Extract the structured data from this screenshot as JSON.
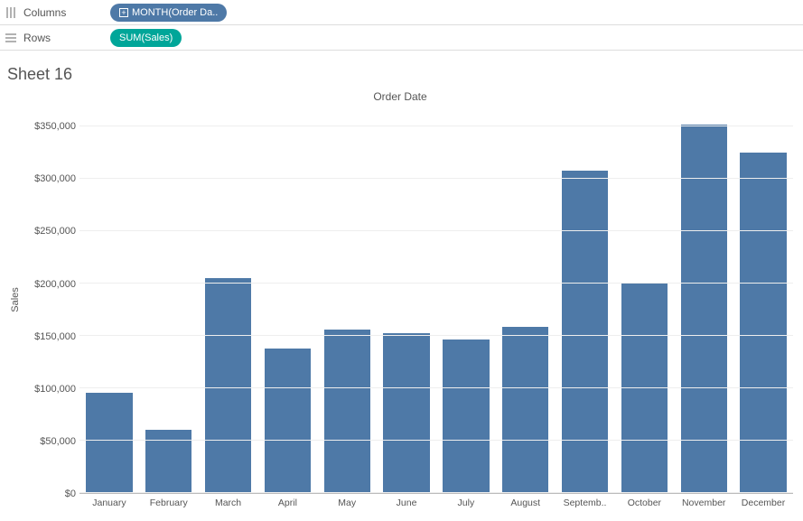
{
  "shelves": {
    "columns_label": "Columns",
    "rows_label": "Rows",
    "columns_pill": "MONTH(Order Da..",
    "rows_pill": "SUM(Sales)"
  },
  "sheet": {
    "title": "Sheet 16"
  },
  "chart_data": {
    "type": "bar",
    "title": "Order Date",
    "xlabel": "",
    "ylabel": "Sales",
    "ylim": [
      0,
      370000
    ],
    "y_ticks": [
      0,
      50000,
      100000,
      150000,
      200000,
      250000,
      300000,
      350000
    ],
    "y_tick_labels": [
      "$0",
      "$50,000",
      "$100,000",
      "$150,000",
      "$200,000",
      "$250,000",
      "$300,000",
      "$350,000"
    ],
    "categories": [
      "January",
      "February",
      "March",
      "April",
      "May",
      "June",
      "July",
      "August",
      "Septemb..",
      "October",
      "November",
      "December"
    ],
    "values": [
      96000,
      60000,
      205000,
      138000,
      156000,
      153000,
      147000,
      159000,
      308000,
      200000,
      352000,
      325000
    ]
  }
}
